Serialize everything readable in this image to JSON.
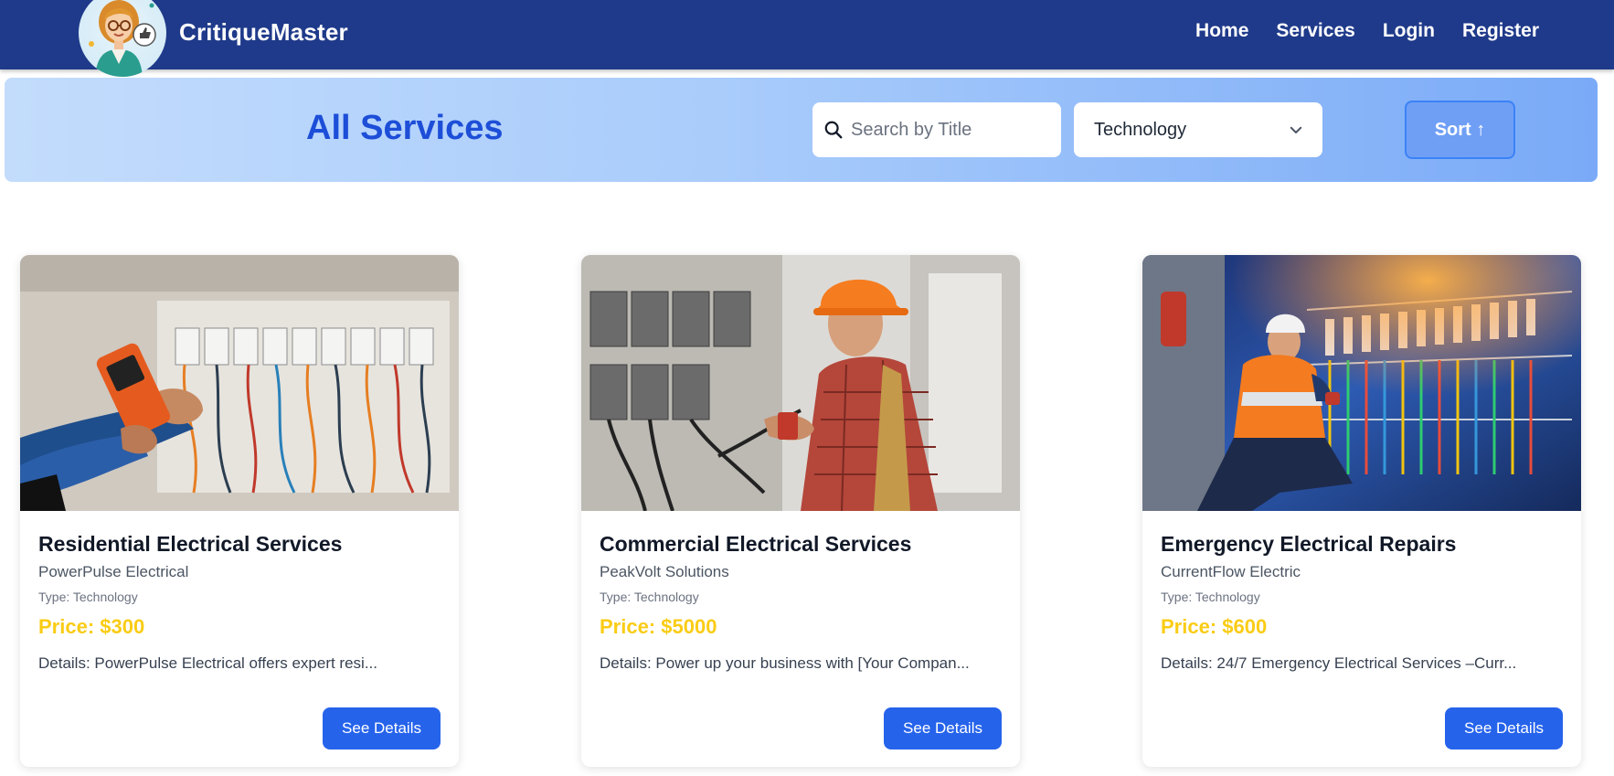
{
  "app": {
    "brand": "CritiqueMaster"
  },
  "nav": {
    "items": [
      {
        "label": "Home"
      },
      {
        "label": "Services"
      },
      {
        "label": "Login"
      },
      {
        "label": "Register"
      }
    ]
  },
  "filters": {
    "title": "All Services",
    "search_placeholder": "Search by Title",
    "category_selected": "Technology",
    "sort_label": "Sort ↑"
  },
  "services": [
    {
      "title": "Residential Electrical Services",
      "company": "PowerPulse Electrical",
      "type": "Type: Technology",
      "price": "Price: $300",
      "details": "Details: PowerPulse Electrical offers expert resi...",
      "button": "See Details"
    },
    {
      "title": "Commercial Electrical Services",
      "company": "PeakVolt Solutions",
      "type": "Type: Technology",
      "price": "Price: $5000",
      "details": "Details: Power up your business with [Your Compan...",
      "button": "See Details"
    },
    {
      "title": "Emergency Electrical Repairs",
      "company": "CurrentFlow Electric",
      "type": "Type: Technology",
      "price": "Price: $600",
      "details": "Details: 24/7 Emergency Electrical Services –Curr...",
      "button": "See Details"
    }
  ],
  "colors": {
    "navbar": "#1f3a8a",
    "accent": "#2563eb",
    "price": "#facc15",
    "title": "#1d4ed8"
  }
}
